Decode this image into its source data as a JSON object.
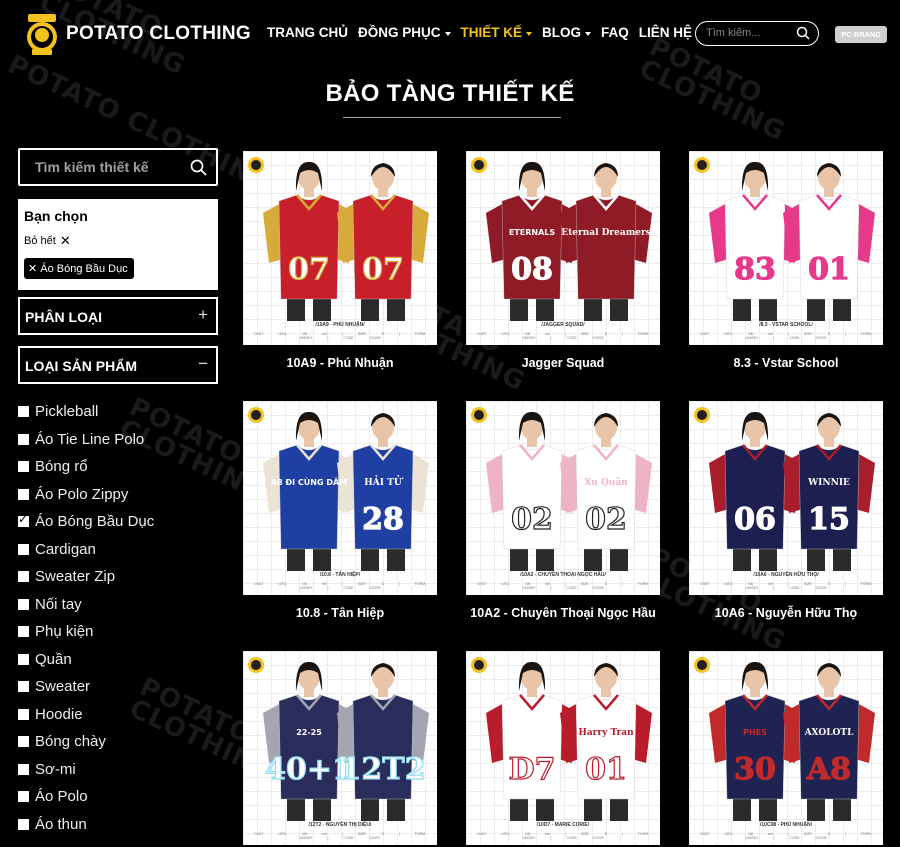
{
  "header": {
    "brand": "POTATO CLOTHING",
    "nav": [
      {
        "label": "TRANG CHỦ",
        "dropdown": false,
        "active": false
      },
      {
        "label": "ĐỒNG PHỤC",
        "dropdown": true,
        "active": false
      },
      {
        "label": "THIẾT KẾ",
        "dropdown": true,
        "active": true
      },
      {
        "label": "BLOG",
        "dropdown": true,
        "active": false
      },
      {
        "label": "FAQ",
        "dropdown": false,
        "active": false
      },
      {
        "label": "LIÊN HỆ",
        "dropdown": false,
        "active": false
      }
    ],
    "search_placeholder": "Tìm kiếm...",
    "pc_brand": "PC BRAND"
  },
  "page_title": "BẢO TÀNG THIẾT KẾ",
  "watermark": "POTATO CLOTHING",
  "sidebar": {
    "search_placeholder": "Tìm kiếm thiết kế",
    "chosen_title": "Bạn chọn",
    "clear_all": "Bỏ hết",
    "chip": "Áo Bóng Bầu Dục",
    "classification": "PHÂN LOẠI",
    "product_type": "LOẠI SẢN PHẨM",
    "categories": [
      {
        "label": "Pickleball",
        "checked": false
      },
      {
        "label": "Áo Tie Line Polo",
        "checked": false
      },
      {
        "label": "Bóng rổ",
        "checked": false
      },
      {
        "label": "Áo Polo Zippy",
        "checked": false
      },
      {
        "label": "Áo Bóng Bầu Dục",
        "checked": true
      },
      {
        "label": "Cardigan",
        "checked": false
      },
      {
        "label": "Sweater Zip",
        "checked": false
      },
      {
        "label": "Nối tay",
        "checked": false
      },
      {
        "label": "Phụ kiện",
        "checked": false
      },
      {
        "label": "Quần",
        "checked": false
      },
      {
        "label": "Sweater",
        "checked": false
      },
      {
        "label": "Hoodie",
        "checked": false
      },
      {
        "label": "Bóng chày",
        "checked": false
      },
      {
        "label": "Sơ-mi",
        "checked": false
      },
      {
        "label": "Áo Polo",
        "checked": false
      },
      {
        "label": "Áo thun",
        "checked": false
      }
    ]
  },
  "products": [
    {
      "title": "10A9 - Phú Nhuận",
      "caption": "/10A9 - PHÚ NHUẬN/",
      "meta": "CHẤT LIỆU: Vải mè | SIZE: S | FORM: UNISEX | CODE: X22/09",
      "shirt": "#c8202a",
      "accent": "#d6ab3a",
      "num1": "07",
      "num2": "07",
      "back_name": "",
      "front_text": "",
      "num_color": "#ffffff",
      "num_stroke": "#d6ab3a"
    },
    {
      "title": "Jagger Squad",
      "caption": "/JAGGER SQUAD/",
      "meta": "CHẤT LIỆU: Vải mè | SIZE: S | FORM: UNISEX | CODE: X22/09",
      "shirt": "#8f1b26",
      "accent": "#ffffff",
      "num1": "08",
      "num2": "",
      "back_name": "Eternal Dreamers",
      "front_text": "ETERNALS",
      "num_color": "#ffffff",
      "num_stroke": "#ffffff"
    },
    {
      "title": "8.3 - Vstar School",
      "caption": "/8.3 - VSTAR SCHOOL/",
      "meta": "CHẤT LIỆU: Vải mè | SIZE: S | FORM: UNISEX | CODE: X22/09",
      "shirt": "#ffffff",
      "accent": "#e6398a",
      "num1": "83",
      "num2": "01",
      "back_name": "",
      "front_text": "",
      "num_color": "#e6398a",
      "num_stroke": "#e6398a"
    },
    {
      "title": "10.8 - Tân Hiệp",
      "caption": "/10.8 - TÂN HIỆP/",
      "meta": "CHẤT LIỆU: Vải mè | SIZE: S | FORM: UNISEX | CODE: X22/09",
      "shirt": "#1f3fa3",
      "accent": "#ebe4d6",
      "num1": "",
      "num2": "28",
      "back_name": "HẢI TỬ",
      "front_text": "A8 ĐI CÙNG DÂM",
      "num_color": "#ffffff",
      "num_stroke": "#ffffff"
    },
    {
      "title": "10A2 - Chuyên Thoại Ngọc Hầu",
      "caption": "/10A2 - CHUYÊN THOẠI NGỌC HẦU/",
      "meta": "CHẤT LIỆU: Vải mè | SIZE: S | FORM: UNISEX | CODE: X22/09",
      "shirt": "#ffffff",
      "accent": "#efb4c4",
      "num1": "02",
      "num2": "02",
      "back_name": "Xu Quân",
      "front_text": "",
      "num_color": "#ffffff",
      "num_stroke": "#222222"
    },
    {
      "title": "10A6 - Nguyễn Hữu Thọ",
      "caption": "/10A6 - NGUYỄN HỮU THỌ/",
      "meta": "CHẤT LIỆU: Vải mè | SIZE: S | FORM: UNISEX | CODE: X22/09",
      "shirt": "#1c1f4f",
      "accent": "#a91e2d",
      "num1": "06",
      "num2": "15",
      "back_name": "WINNIE",
      "front_text": "",
      "num_color": "#ffffff",
      "num_stroke": "#ffffff"
    },
    {
      "title": "12T2 - Nguyễn Thị Diệu",
      "caption": "/12T2 - NGUYỄN THỊ DIỆU/",
      "meta": "CHẤT LIỆU: Vải mè | SIZE: S | FORM: UNISEX | CODE: X22/07",
      "shirt": "#2a2d5c",
      "accent": "#a3a6b0",
      "num1": "40+1",
      "num2": "12T2",
      "back_name": "",
      "front_text": "22-25",
      "num_color": "#ffffff",
      "num_stroke": "#8fd8f0"
    },
    {
      "title": "10D7 - Marie Curie",
      "caption": "/10D7 - MARIE CURIE/",
      "meta": "CHẤT LIỆU: Vải mè | SIZE: S | FORM: UNISEX | CODE: X22/09",
      "shirt": "#ffffff",
      "accent": "#b91c2a",
      "num1": "D7",
      "num2": "01",
      "back_name": "Harry Tran",
      "front_text": "",
      "num_color": "#ffffff",
      "num_stroke": "#b91c2a"
    },
    {
      "title": "10C08 - Phú Nhuận",
      "caption": "/10C08 - PHÚ NHUẬN/",
      "meta": "CHẤT LIỆU: Vải mè | SIZE: S | FORM: UNISEX | CODE: X22/09",
      "shirt": "#1e2352",
      "accent": "#c02a2a",
      "num1": "30",
      "num2": "A8",
      "back_name": "AXOLOTL",
      "front_text": "PHES",
      "num_color": "#c02a2a",
      "num_stroke": "#c02a2a"
    }
  ]
}
